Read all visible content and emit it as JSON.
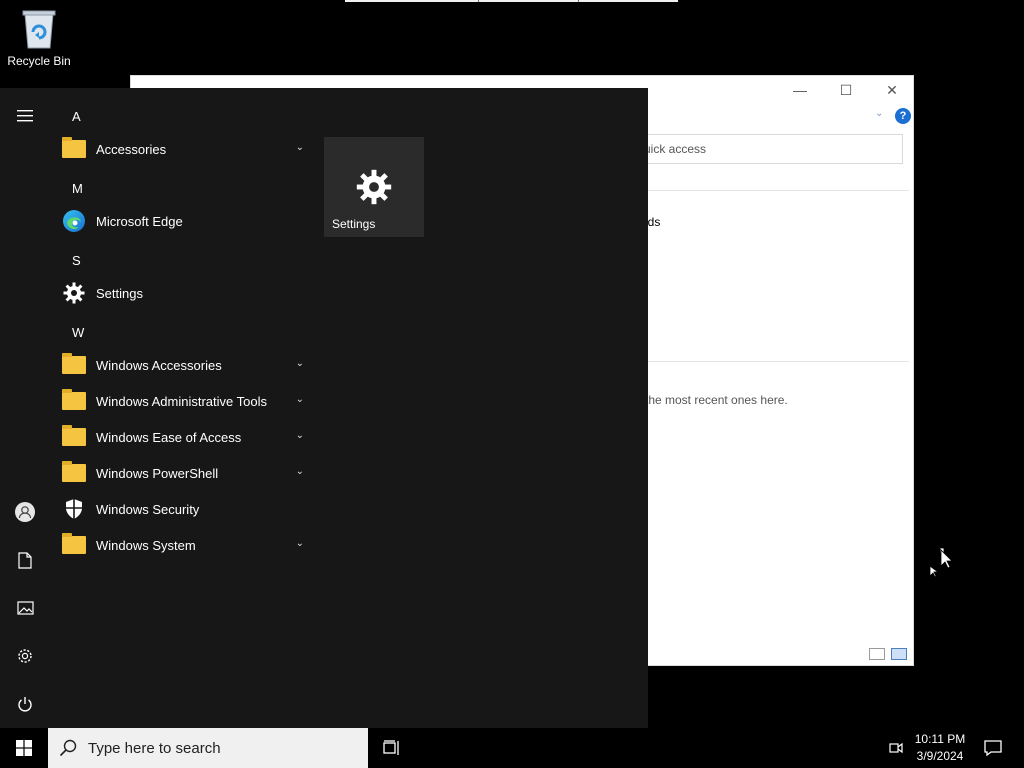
{
  "desktop": {
    "recycle_bin_label": "Recycle Bin"
  },
  "explorer": {
    "search_placeholder": "uick access",
    "downloads_fragment": "ads",
    "recent_hint": "the most recent ones here.",
    "help_label": "?",
    "minimize_glyph": "—",
    "maximize_glyph": "☐",
    "close_glyph": "✕"
  },
  "start_menu": {
    "sections": [
      {
        "letter": "A"
      },
      {
        "letter": "M"
      },
      {
        "letter": "S"
      },
      {
        "letter": "W"
      }
    ],
    "apps": [
      {
        "label": "Accessories",
        "icon": "folder-icon",
        "expandable": true
      },
      {
        "label": "Microsoft Edge",
        "icon": "edge-icon",
        "expandable": false
      },
      {
        "label": "Settings",
        "icon": "gear-icon",
        "expandable": false
      },
      {
        "label": "Windows Accessories",
        "icon": "folder-icon",
        "expandable": true
      },
      {
        "label": "Windows Administrative Tools",
        "icon": "folder-icon",
        "expandable": true
      },
      {
        "label": "Windows Ease of Access",
        "icon": "folder-icon",
        "expandable": true
      },
      {
        "label": "Windows PowerShell",
        "icon": "folder-icon",
        "expandable": true
      },
      {
        "label": "Windows Security",
        "icon": "shield-icon",
        "expandable": false
      },
      {
        "label": "Windows System",
        "icon": "folder-icon",
        "expandable": true
      }
    ],
    "tile": {
      "label": "Settings",
      "icon": "gear-icon"
    },
    "rail": [
      "hamburger-icon",
      "user-icon",
      "document-icon",
      "pictures-icon",
      "gear-icon",
      "power-icon"
    ]
  },
  "taskbar": {
    "search_placeholder": "Type here to search",
    "time": "10:11 PM",
    "date": "3/9/2024"
  },
  "colors": {
    "start_bg": "#171717",
    "tile_bg": "#2b2b2b",
    "folder": "#f5c542",
    "accent": "#1a6fd1"
  }
}
